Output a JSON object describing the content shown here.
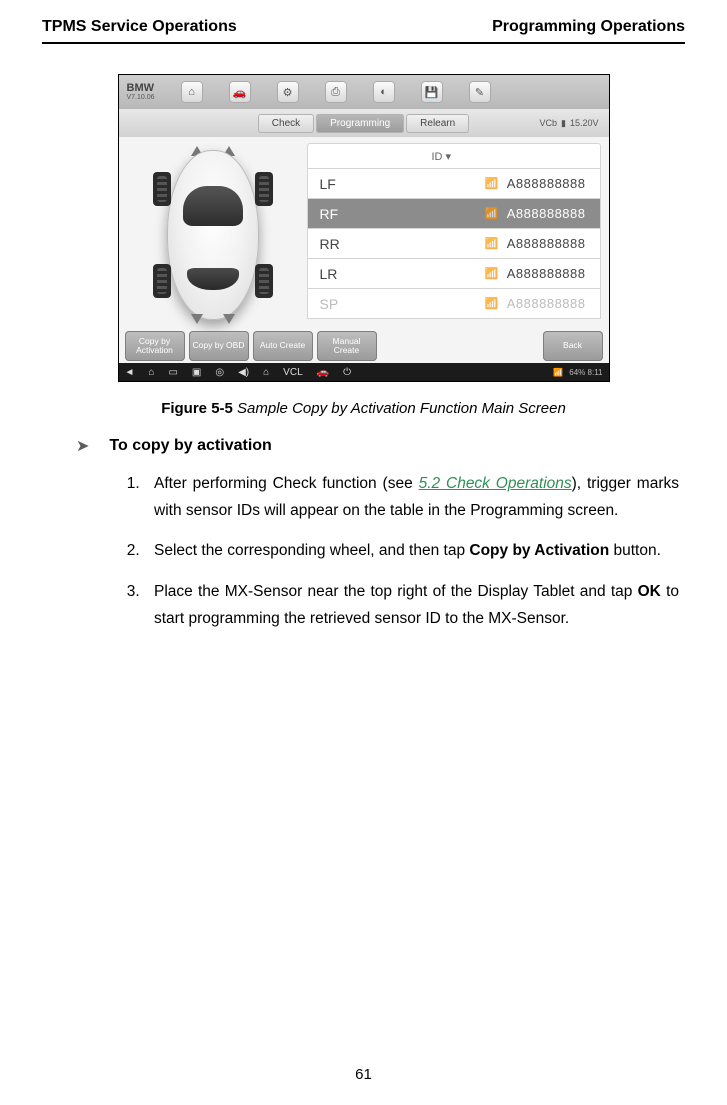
{
  "header": {
    "left": "TPMS Service Operations",
    "right": "Programming Operations"
  },
  "figure": {
    "brand": "BMW",
    "version": "V7.10.06",
    "tabs": {
      "check": "Check",
      "programming": "Programming",
      "relearn": "Relearn"
    },
    "vc_label": "VCb",
    "voltage": "15.20V",
    "table_header": "ID ▾",
    "rows": [
      {
        "pos": "LF",
        "id": "A888888888",
        "selected": false,
        "grey": false
      },
      {
        "pos": "RF",
        "id": "A888888888",
        "selected": true,
        "grey": false
      },
      {
        "pos": "RR",
        "id": "A888888888",
        "selected": false,
        "grey": false
      },
      {
        "pos": "LR",
        "id": "A888888888",
        "selected": false,
        "grey": false
      },
      {
        "pos": "SP",
        "id": "A888888888",
        "selected": false,
        "grey": true
      }
    ],
    "buttons": {
      "copy_activation": "Copy by Activation",
      "copy_obd": "Copy by OBD",
      "auto_create": "Auto Create",
      "manual_create": "Manual Create",
      "back": "Back"
    },
    "sysbar_time": "64% 8:11"
  },
  "caption": {
    "label": "Figure 5-5",
    "text": " Sample Copy by Activation Function Main Screen"
  },
  "procedure_title": "To copy by activation",
  "steps": {
    "s1a": "After performing Check function (see ",
    "s1_link": "5.2 Check Operations",
    "s1b": "), trigger marks with sensor IDs will appear on the table in the Programming screen.",
    "s2a": "Select the corresponding wheel, and then tap ",
    "s2_bold": "Copy by Activation",
    "s2b": " button.",
    "s3a": "Place the MX-Sensor near the top right of the Display Tablet and tap ",
    "s3_bold": "OK",
    "s3b": " to start programming the retrieved sensor ID to the MX-Sensor."
  },
  "page_number": "61"
}
